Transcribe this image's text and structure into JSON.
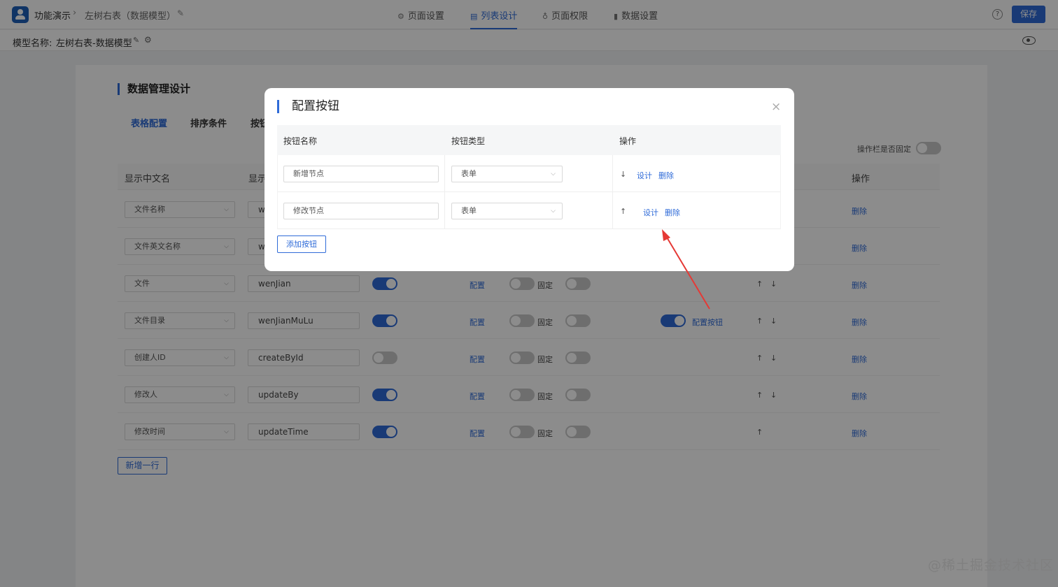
{
  "topbar": {
    "app_name": "功能演示",
    "breadcrumb_sep": "›",
    "model_title": "左树右表（数据模型）",
    "tabs": [
      {
        "label": "页面设置",
        "icon": "⚙"
      },
      {
        "label": "列表设计",
        "icon": "▤"
      },
      {
        "label": "页面权限",
        "icon": "♁"
      },
      {
        "label": "数据设置",
        "icon": "▮"
      }
    ],
    "help": "?",
    "save_label": "保存"
  },
  "subbar": {
    "label": "模型名称:",
    "name": "左树右表-数据模型",
    "edit_icon": "✎",
    "gear_icon": "⚙"
  },
  "design": {
    "title": "数据管理设计",
    "subtabs": [
      "表格配置",
      "排序条件",
      "按钮"
    ],
    "fix_label": "操作栏是否固定",
    "headers": {
      "cn_name": "显示中文名",
      "col2": "显示",
      "ops": "操作"
    },
    "rows": [
      {
        "cn": "文件名称",
        "en": "w",
        "ops": "删除",
        "up": "",
        "down": ""
      },
      {
        "cn": "文件英文名称",
        "en": "w",
        "ops": "删除",
        "up": "",
        "down": ""
      },
      {
        "cn": "文件",
        "en": "wenJian",
        "config": "配置",
        "fixed": "固定",
        "up": "↑",
        "down": "↓",
        "ops": "删除"
      },
      {
        "cn": "文件目录",
        "en": "wenJianMuLu",
        "config": "配置",
        "fixed": "固定",
        "btn_config": "配置按钮",
        "up": "↑",
        "down": "↓",
        "ops": "删除"
      },
      {
        "cn": "创建人ID",
        "en": "createById",
        "config": "配置",
        "fixed": "固定",
        "up": "↑",
        "down": "↓",
        "ops": "删除"
      },
      {
        "cn": "修改人",
        "en": "updateBy",
        "config": "配置",
        "fixed": "固定",
        "up": "↑",
        "down": "↓",
        "ops": "删除"
      },
      {
        "cn": "修改时间",
        "en": "updateTime",
        "config": "配置",
        "fixed": "固定",
        "up": "↑",
        "down": "",
        "ops": "删除"
      }
    ],
    "add_row": "新增一行"
  },
  "modal": {
    "title": "配置按钮",
    "close": "×",
    "headers": {
      "name": "按钮名称",
      "type": "按钮类型",
      "ops": "操作"
    },
    "rows": [
      {
        "name": "新增节点",
        "type": "表单",
        "arrow": "↓",
        "design": "设计",
        "delete": "删除"
      },
      {
        "name": "修改节点",
        "type": "表单",
        "arrow": "↑",
        "design": "设计",
        "delete": "删除"
      }
    ],
    "add_button": "添加按钮"
  },
  "watermark": "@稀土掘金技术社区",
  "colors": {
    "accent": "#2f6bd8",
    "annotation": "#e53935"
  }
}
